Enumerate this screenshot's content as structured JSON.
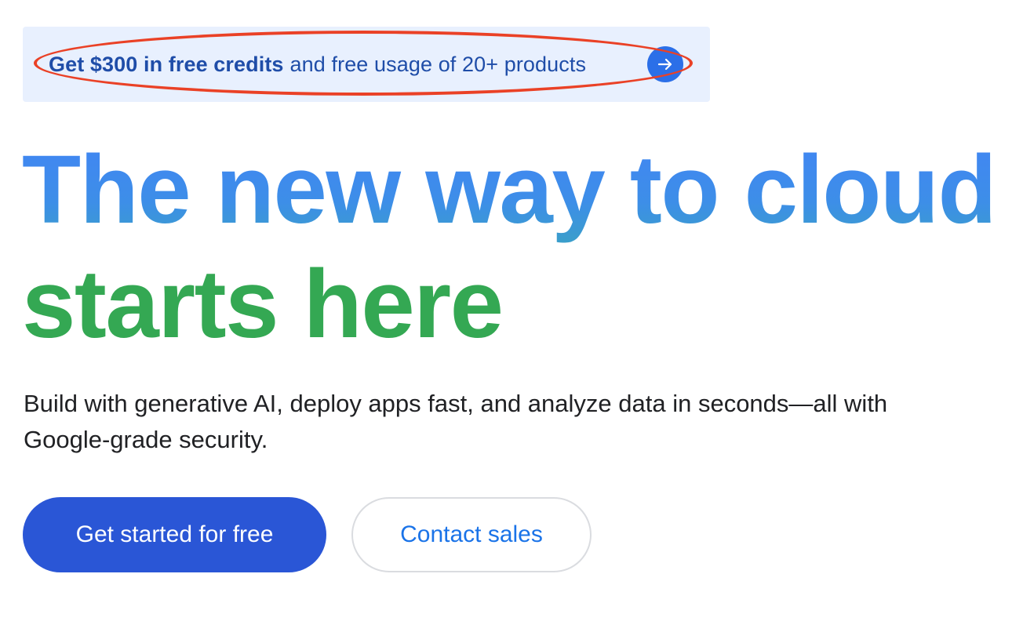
{
  "promo": {
    "strong_text": "Get $300 in free credits",
    "rest_text": "and free usage of 20+ products",
    "arrow_icon": "arrow-right-icon",
    "background_color": "#e8f0fe",
    "text_color": "#1f4da8",
    "arrow_bg_color": "#2b6fe8",
    "highlight_color": "#ea4126"
  },
  "hero": {
    "headline_line1": "The new way to cloud",
    "headline_line2": "starts here",
    "line1_color": "#4285f4",
    "line2_color": "#34a853",
    "subtitle": "Build with generative AI, deploy apps fast, and analyze data in seconds—all with Google-grade security."
  },
  "actions": {
    "primary_label": "Get started for free",
    "secondary_label": "Contact sales",
    "primary_color": "#2a56d6",
    "secondary_text_color": "#1a73e8"
  }
}
